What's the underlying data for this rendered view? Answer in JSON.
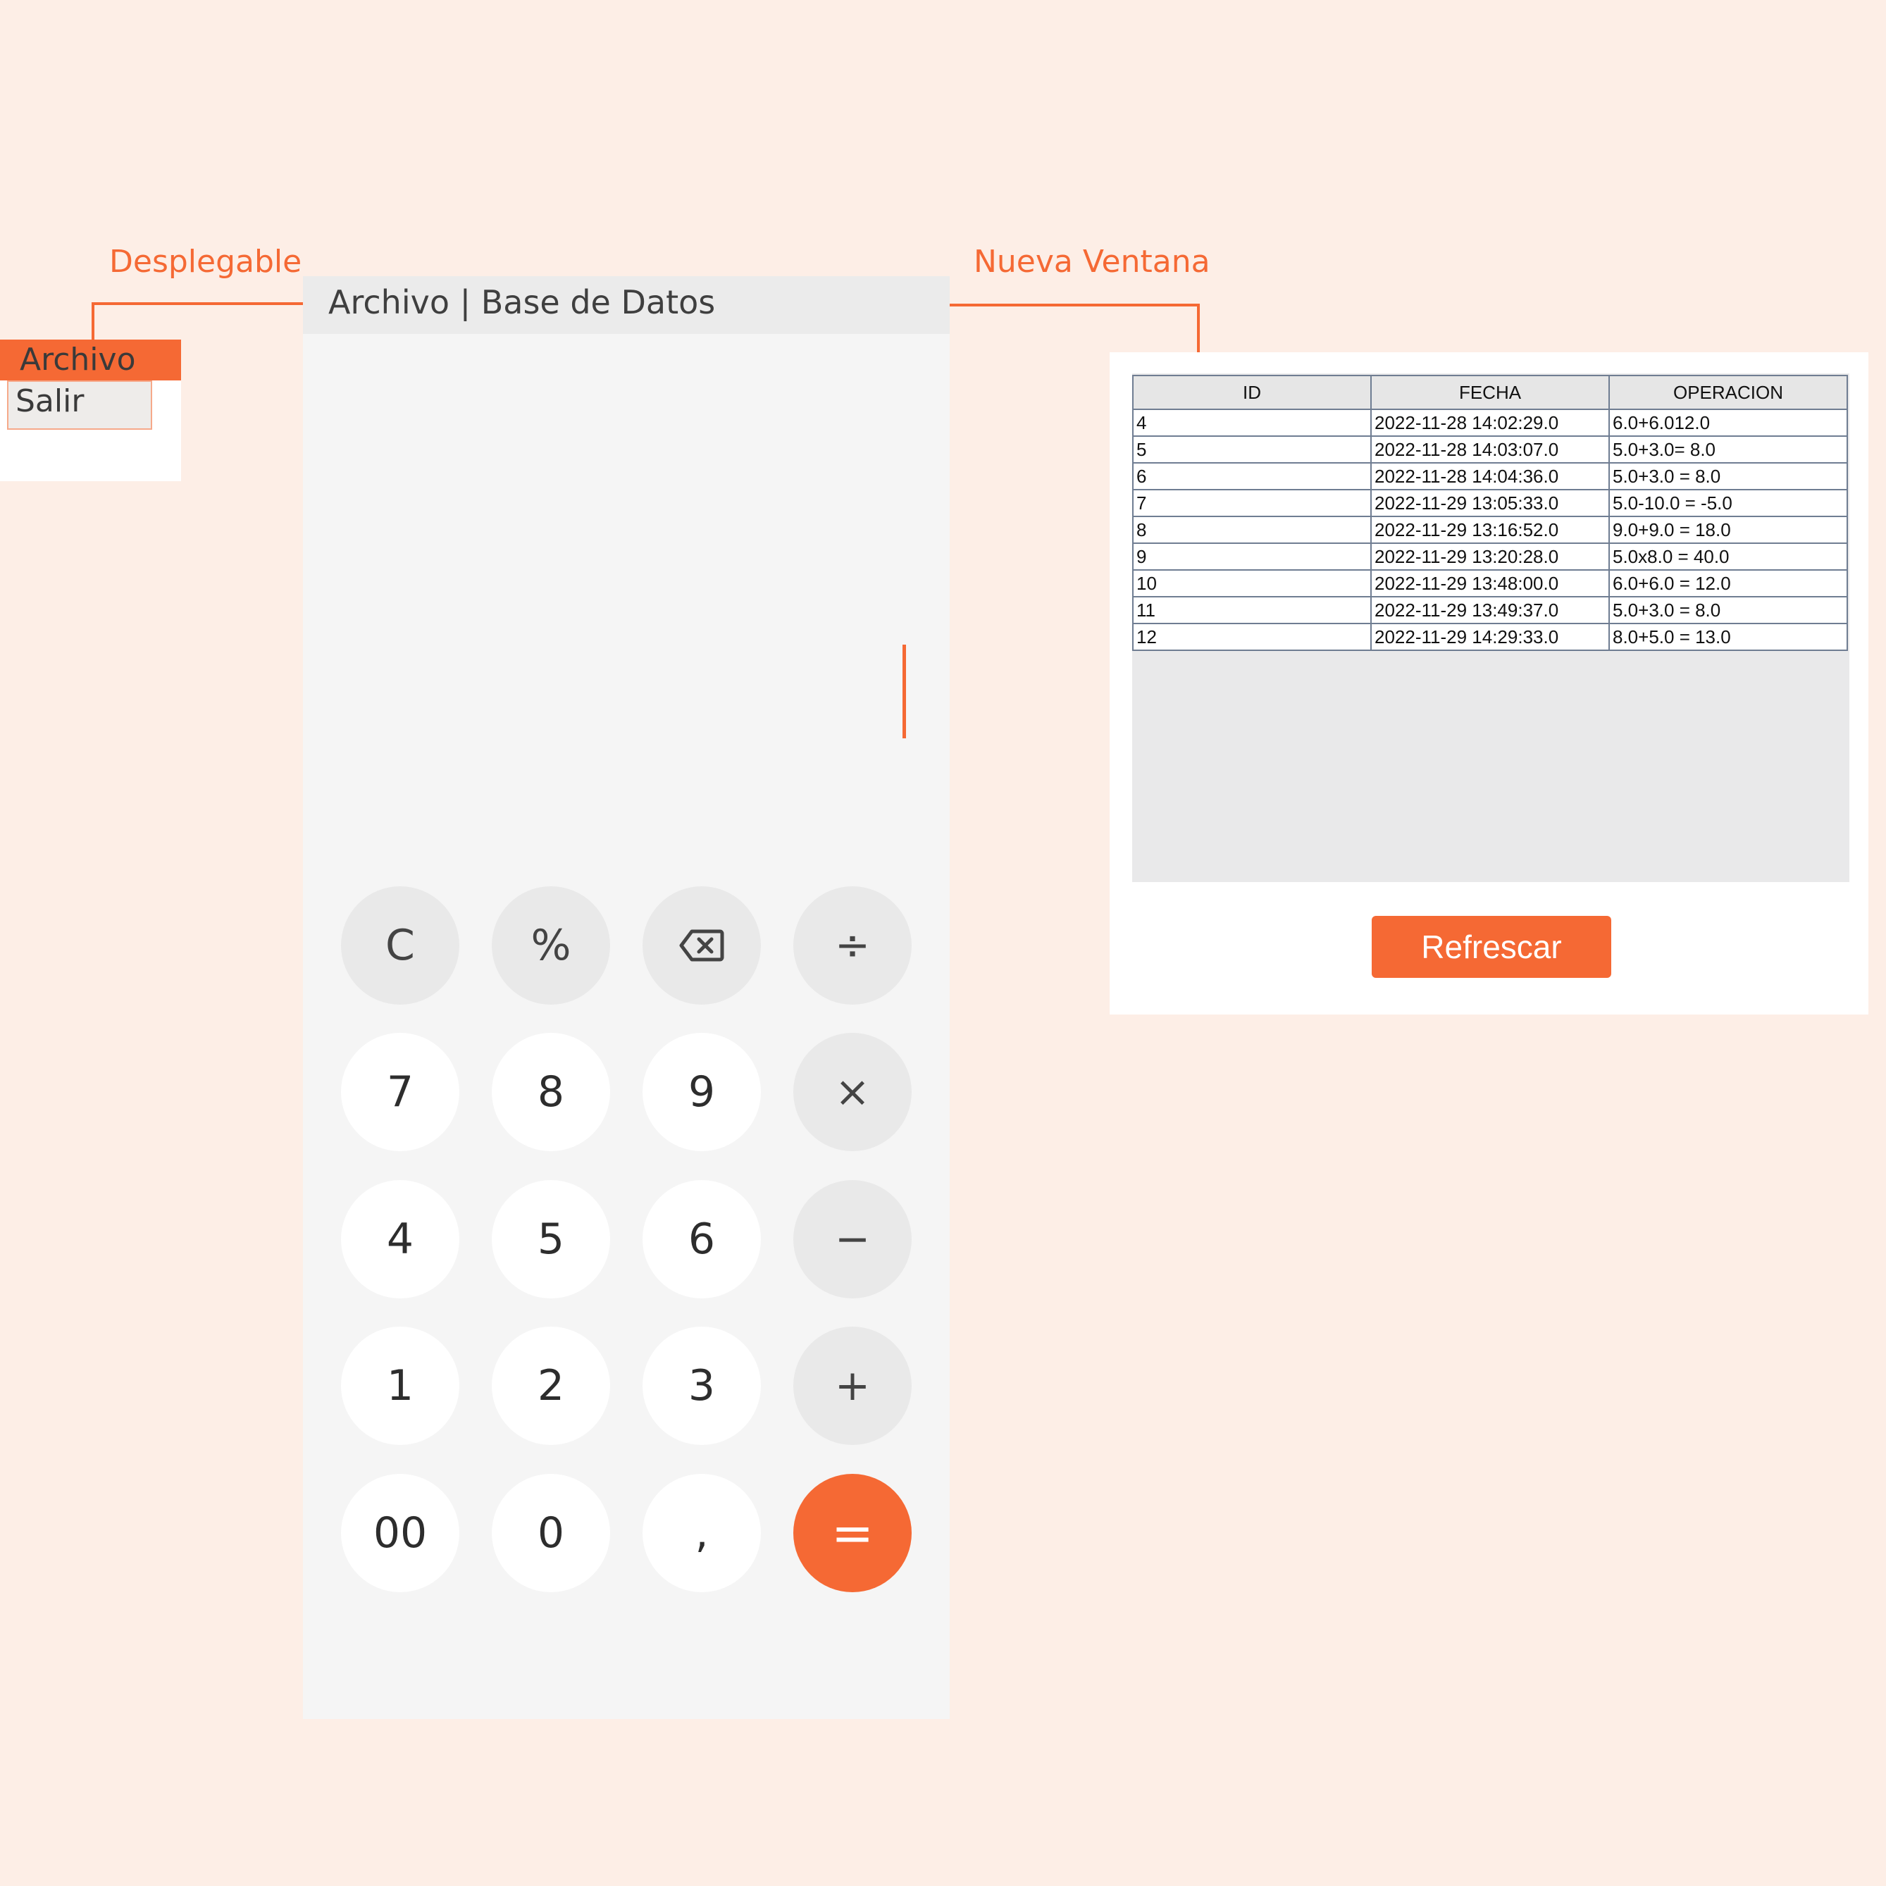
{
  "annotations": {
    "left_label": "Desplegable",
    "right_label": "Nueva Ventana"
  },
  "dropdown": {
    "header": "Archivo",
    "item": "Salir"
  },
  "calculator": {
    "menubar": "Archivo | Base de Datos",
    "keys": {
      "clear": "C",
      "percent": "%",
      "backspace": "backspace-icon",
      "divide": "÷",
      "seven": "7",
      "eight": "8",
      "nine": "9",
      "multiply": "×",
      "four": "4",
      "five": "5",
      "six": "6",
      "minus": "−",
      "one": "1",
      "two": "2",
      "three": "3",
      "plus": "+",
      "double_zero": "00",
      "zero": "0",
      "comma": ",",
      "equals": "="
    },
    "colors": {
      "accent": "#F56934",
      "keypad_bg": "#F5F5F5",
      "operator_bg": "#E9E9E9"
    }
  },
  "window": {
    "columns": [
      "ID",
      "FECHA",
      "OPERACION"
    ],
    "rows": [
      [
        "4",
        "2022-11-28 14:02:29.0",
        "6.0+6.012.0"
      ],
      [
        "5",
        "2022-11-28 14:03:07.0",
        "5.0+3.0= 8.0"
      ],
      [
        "6",
        "2022-11-28 14:04:36.0",
        "5.0+3.0 = 8.0"
      ],
      [
        "7",
        "2022-11-29 13:05:33.0",
        "5.0-10.0 = -5.0"
      ],
      [
        "8",
        "2022-11-29 13:16:52.0",
        "9.0+9.0 = 18.0"
      ],
      [
        "9",
        "2022-11-29 13:20:28.0",
        "5.0x8.0 = 40.0"
      ],
      [
        "10",
        "2022-11-29 13:48:00.0",
        "6.0+6.0 = 12.0"
      ],
      [
        "11",
        "2022-11-29 13:49:37.0",
        "5.0+3.0 = 8.0"
      ],
      [
        "12",
        "2022-11-29 14:29:33.0",
        "8.0+5.0 = 13.0"
      ]
    ],
    "refresh_button": "Refrescar"
  }
}
